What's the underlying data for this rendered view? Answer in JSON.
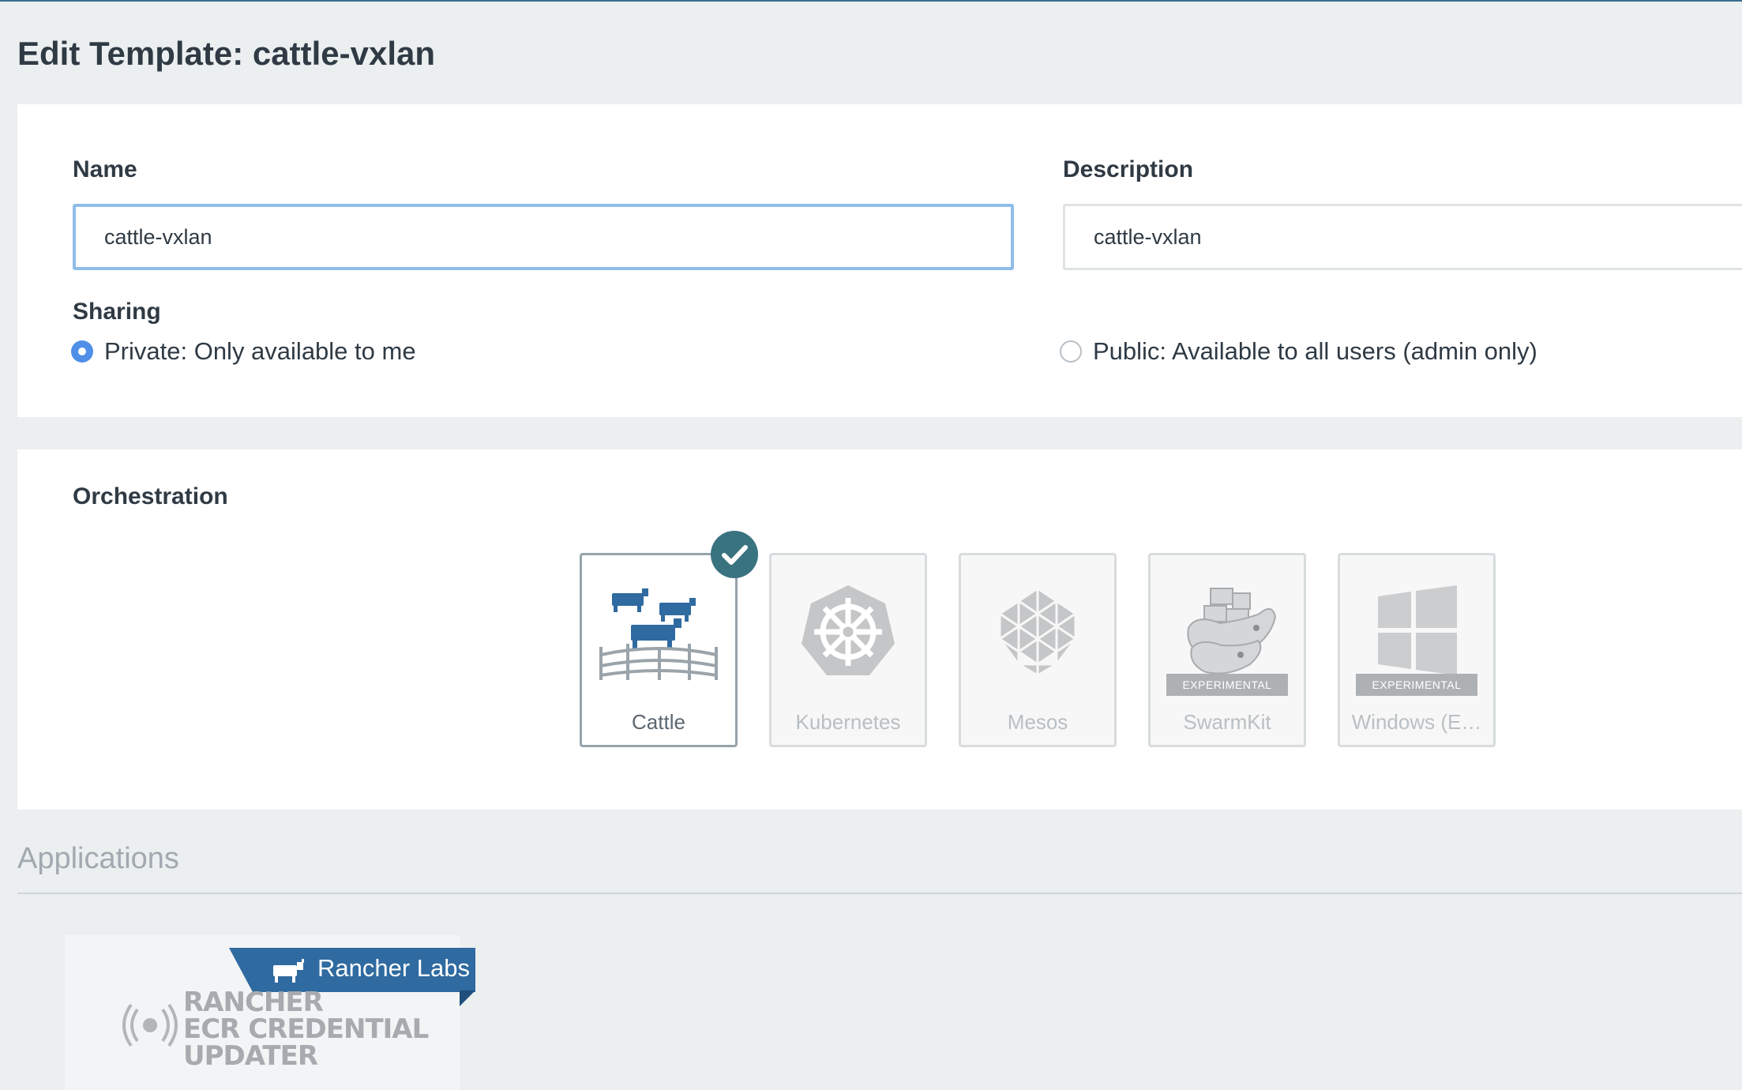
{
  "page": {
    "title": "Edit Template: cattle-vxlan"
  },
  "form": {
    "name_label": "Name",
    "name_value": "cattle-vxlan",
    "description_label": "Description",
    "description_value": "cattle-vxlan",
    "sharing_label": "Sharing",
    "sharing_options": [
      {
        "label": "Private: Only available to me",
        "selected": true
      },
      {
        "label": "Public: Available to all users (admin only)",
        "selected": false
      }
    ]
  },
  "orchestration": {
    "label": "Orchestration",
    "options": [
      {
        "label": "Cattle",
        "selected": true,
        "icon": "cattle-herd-icon"
      },
      {
        "label": "Kubernetes",
        "selected": false,
        "icon": "kubernetes-helm-icon"
      },
      {
        "label": "Mesos",
        "selected": false,
        "icon": "mesos-icon"
      },
      {
        "label": "SwarmKit",
        "selected": false,
        "icon": "docker-whale-icon",
        "badge": "EXPERIMENTAL"
      },
      {
        "label": "Windows (E…",
        "selected": false,
        "icon": "windows-icon",
        "badge": "EXPERIMENTAL"
      }
    ]
  },
  "applications": {
    "title": "Applications",
    "cards": [
      {
        "ribbon": "Rancher Labs",
        "logo_lines": [
          "RANCHER",
          "ECR CREDENTIAL",
          "UPDATER"
        ]
      }
    ]
  },
  "colors": {
    "accent": "#4f8fe8",
    "check_badge": "#3a7380",
    "ribbon": "#2f6aa0",
    "cattle_blue": "#2f6aa0"
  }
}
